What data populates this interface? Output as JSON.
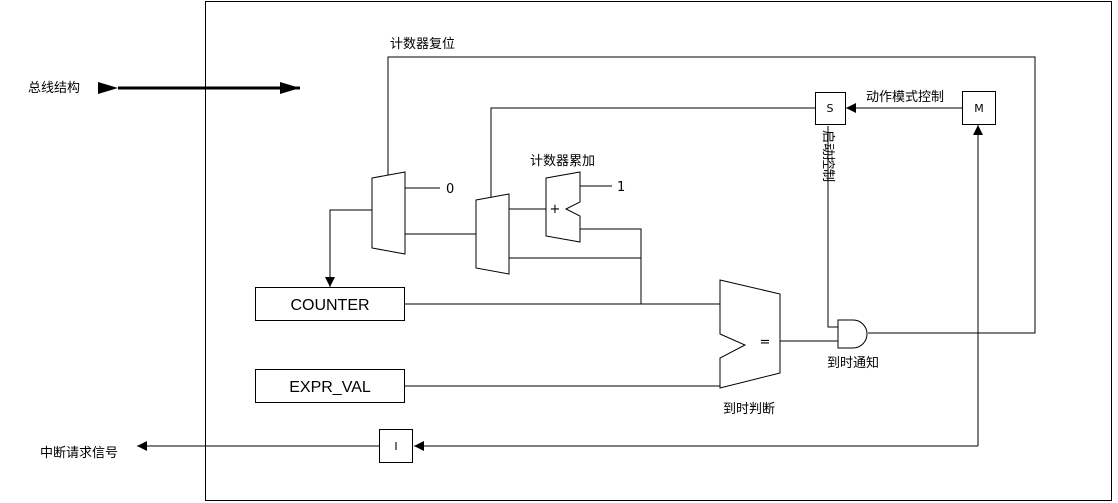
{
  "labels": {
    "bus": "总线结构",
    "counter_reset": "计数器复位",
    "counter_accumulate": "计数器累加",
    "mode_control": "动作模式控制",
    "start_control": "启动控制",
    "timeout_notify": "到时通知",
    "timeout_judge": "到时判断",
    "irq": "中断请求信号"
  },
  "registers": {
    "counter": "COUNTER",
    "expr_val": "EXPR_VAL"
  },
  "constants": {
    "zero": "0",
    "one": "1"
  },
  "blocks": {
    "s": "S",
    "m": "M",
    "i": "I",
    "plus": "+",
    "equals": "="
  }
}
